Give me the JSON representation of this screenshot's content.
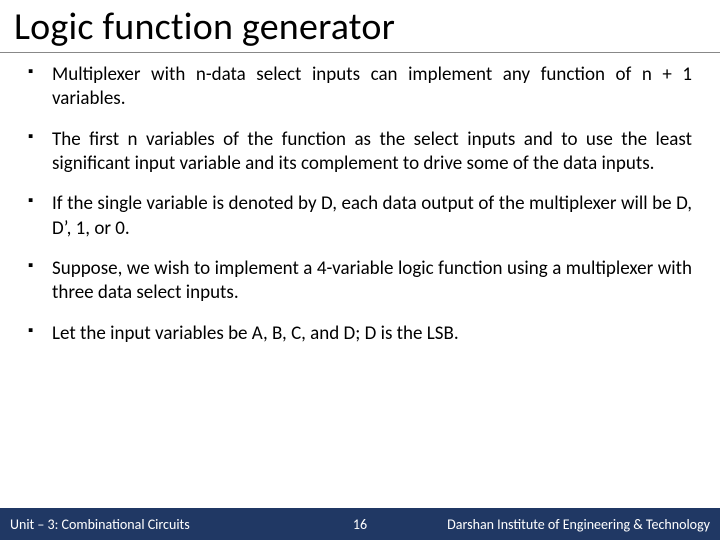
{
  "title": "Logic function generator",
  "bullets": [
    "Multiplexer with n-data select inputs can implement any function of n + 1 variables.",
    "The first n variables of the function as the select inputs and to use the least significant input variable and its complement to drive some of the data inputs.",
    "If the single variable is denoted by D, each data output of the multiplexer will be D, D’, 1, or 0.",
    "Suppose, we wish to implement a 4-variable logic function using a multiplexer with three data select inputs.",
    "Let the input variables be A, B, C, and D; D is the LSB."
  ],
  "footer": {
    "left": "Unit – 3: Combinational Circuits",
    "page": "16",
    "right": "Darshan Institute of Engineering & Technology"
  }
}
